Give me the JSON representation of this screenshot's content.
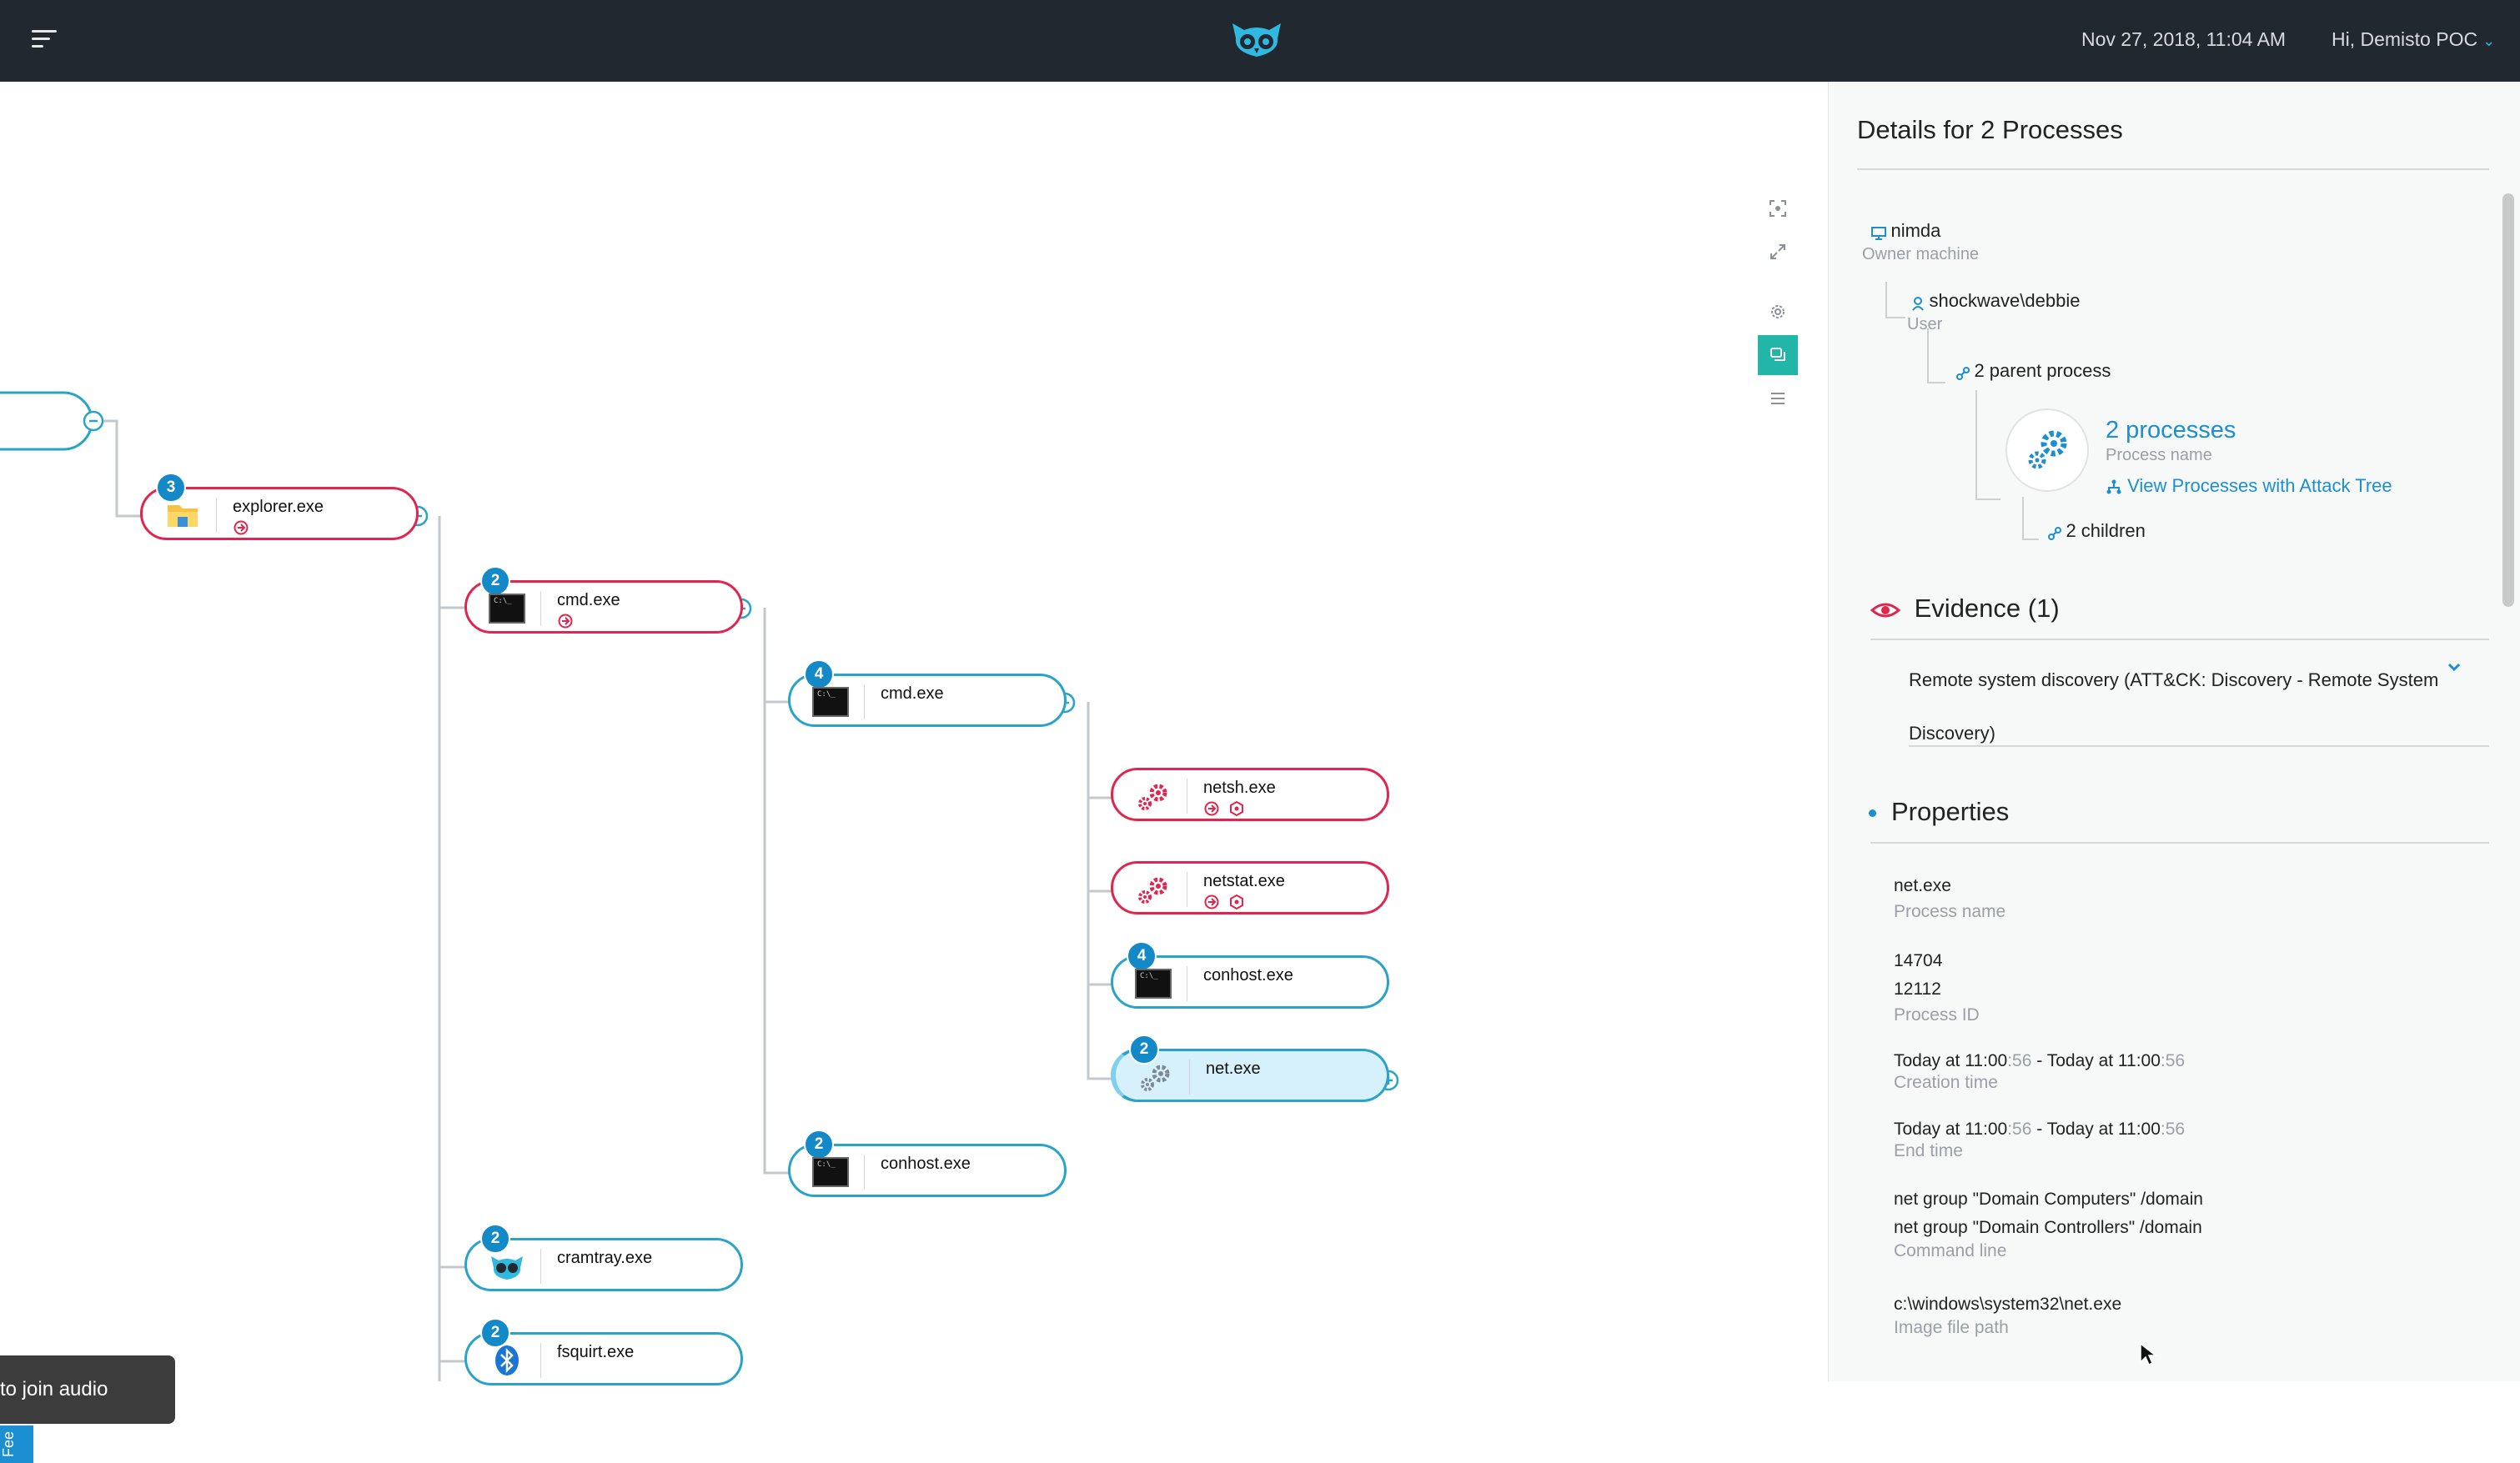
{
  "topbar": {
    "datetime": "Nov 27, 2018, 11:04 AM",
    "user_greeting": "Hi, Demisto POC",
    "user_chevron": "⌄",
    "brand_color": "#2fb9e0"
  },
  "tree": {
    "nodes": [
      {
        "id": "explorer",
        "label": "explorer.exe",
        "badge": "3",
        "status": "red",
        "icon": "folder-icon"
      },
      {
        "id": "cmd1",
        "label": "cmd.exe",
        "badge": "2",
        "status": "red",
        "icon": "terminal-icon"
      },
      {
        "id": "cmd2",
        "label": "cmd.exe",
        "badge": "4",
        "status": "normal",
        "icon": "terminal-icon"
      },
      {
        "id": "netsh",
        "label": "netsh.exe",
        "badge": "",
        "status": "red",
        "icon": "gears-icon"
      },
      {
        "id": "netstat",
        "label": "netstat.exe",
        "badge": "",
        "status": "red",
        "icon": "gears-icon"
      },
      {
        "id": "conhost1",
        "label": "conhost.exe",
        "badge": "4",
        "status": "normal",
        "icon": "terminal-icon"
      },
      {
        "id": "net",
        "label": "net.exe",
        "badge": "2",
        "status": "selected",
        "icon": "gears-icon"
      },
      {
        "id": "conhost2",
        "label": "conhost.exe",
        "badge": "2",
        "status": "normal",
        "icon": "terminal-icon"
      },
      {
        "id": "cramtray",
        "label": "cramtray.exe",
        "badge": "2",
        "status": "normal",
        "icon": "owl-icon"
      },
      {
        "id": "fsquirt",
        "label": "fsquirt.exe",
        "badge": "2",
        "status": "normal",
        "icon": "bluetooth-icon"
      }
    ]
  },
  "overlay": {
    "audio_toast": "to join audio",
    "feedback_tab": "Fee"
  },
  "details": {
    "title": "Details for 2 Processes",
    "hierarchy": {
      "machine_name": "nimda",
      "machine_label": "Owner machine",
      "user_name": "shockwave\\debbie",
      "user_label": "User",
      "parent_text": "2 parent process",
      "processes_title": "2 processes",
      "processes_label": "Process name",
      "attack_tree_link": "View Processes with Attack Tree",
      "children_text": "2 children"
    },
    "evidence": {
      "title": "Evidence (1)",
      "line1": "Remote system discovery (ATT&CK: Discovery - Remote System",
      "line2": "Discovery)"
    },
    "properties": {
      "title": "Properties",
      "process_name": "net.exe",
      "process_name_label": "Process name",
      "pid_1": "14704",
      "pid_2": "12112",
      "pid_label": "Process ID",
      "creation_a": "Today at 11:00",
      "creation_b": ":56",
      "creation_c": " - Today at 11:00",
      "creation_d": ":56",
      "creation_label": "Creation time",
      "end_a": "Today at 11:00",
      "end_b": ":56",
      "end_c": " - Today at 11:00",
      "end_d": ":56",
      "end_label": "End time",
      "cmd_1": "net group \"Domain Computers\" /domain",
      "cmd_2": "net group \"Domain Controllers\" /domain",
      "cmd_label": "Command line",
      "image_path": "c:\\windows\\system32\\net.exe",
      "image_path_label": "Image file path"
    }
  }
}
